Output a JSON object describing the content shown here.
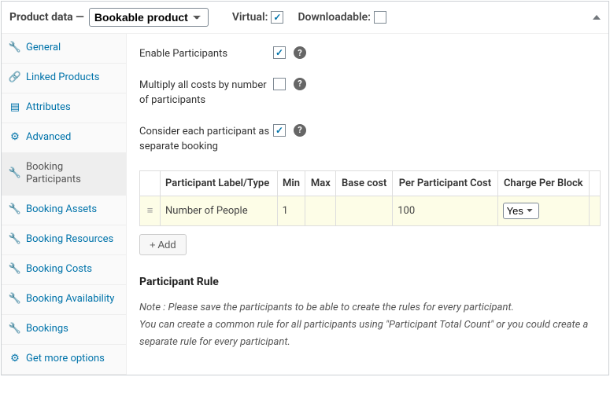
{
  "header": {
    "title": "Product data —",
    "product_type": "Bookable product",
    "virtual_label": "Virtual:",
    "virtual_checked": true,
    "downloadable_label": "Downloadable:",
    "downloadable_checked": false
  },
  "sidebar": {
    "tabs": [
      {
        "icon": "wrench",
        "label": "General"
      },
      {
        "icon": "link",
        "label": "Linked Products"
      },
      {
        "icon": "list",
        "label": "Attributes"
      },
      {
        "icon": "gear",
        "label": "Advanced"
      },
      {
        "icon": "wrench",
        "label": "Booking Participants",
        "active": true
      },
      {
        "icon": "wrench",
        "label": "Booking Assets"
      },
      {
        "icon": "wrench",
        "label": "Booking Resources"
      },
      {
        "icon": "wrench",
        "label": "Booking Costs"
      },
      {
        "icon": "wrench",
        "label": "Booking Availability"
      },
      {
        "icon": "wrench",
        "label": "Bookings"
      },
      {
        "icon": "gear",
        "label": "Get more options"
      }
    ]
  },
  "options": {
    "enable_participants": {
      "label": "Enable Participants",
      "checked": true
    },
    "multiply_costs": {
      "label": "Multiply all costs by number of participants",
      "checked": false
    },
    "separate_booking": {
      "label": "Consider each participant as separate booking",
      "checked": true
    }
  },
  "table": {
    "headers": {
      "label": "Participant Label/Type",
      "min": "Min",
      "max": "Max",
      "base": "Base cost",
      "per": "Per Participant Cost",
      "charge": "Charge Per Block"
    },
    "rows": [
      {
        "label": "Number of People",
        "min": "1",
        "max": "",
        "base": "",
        "per": "100",
        "charge": "Yes"
      }
    ],
    "add_button": "+ Add"
  },
  "rules": {
    "heading": "Participant Rule",
    "note_line1": "Note : Please save the participants to be able to create the rules for every participant.",
    "note_line2": "You can create a common rule for all participants using \"Participant Total Count\" or you could create a separate rule for every participant."
  }
}
